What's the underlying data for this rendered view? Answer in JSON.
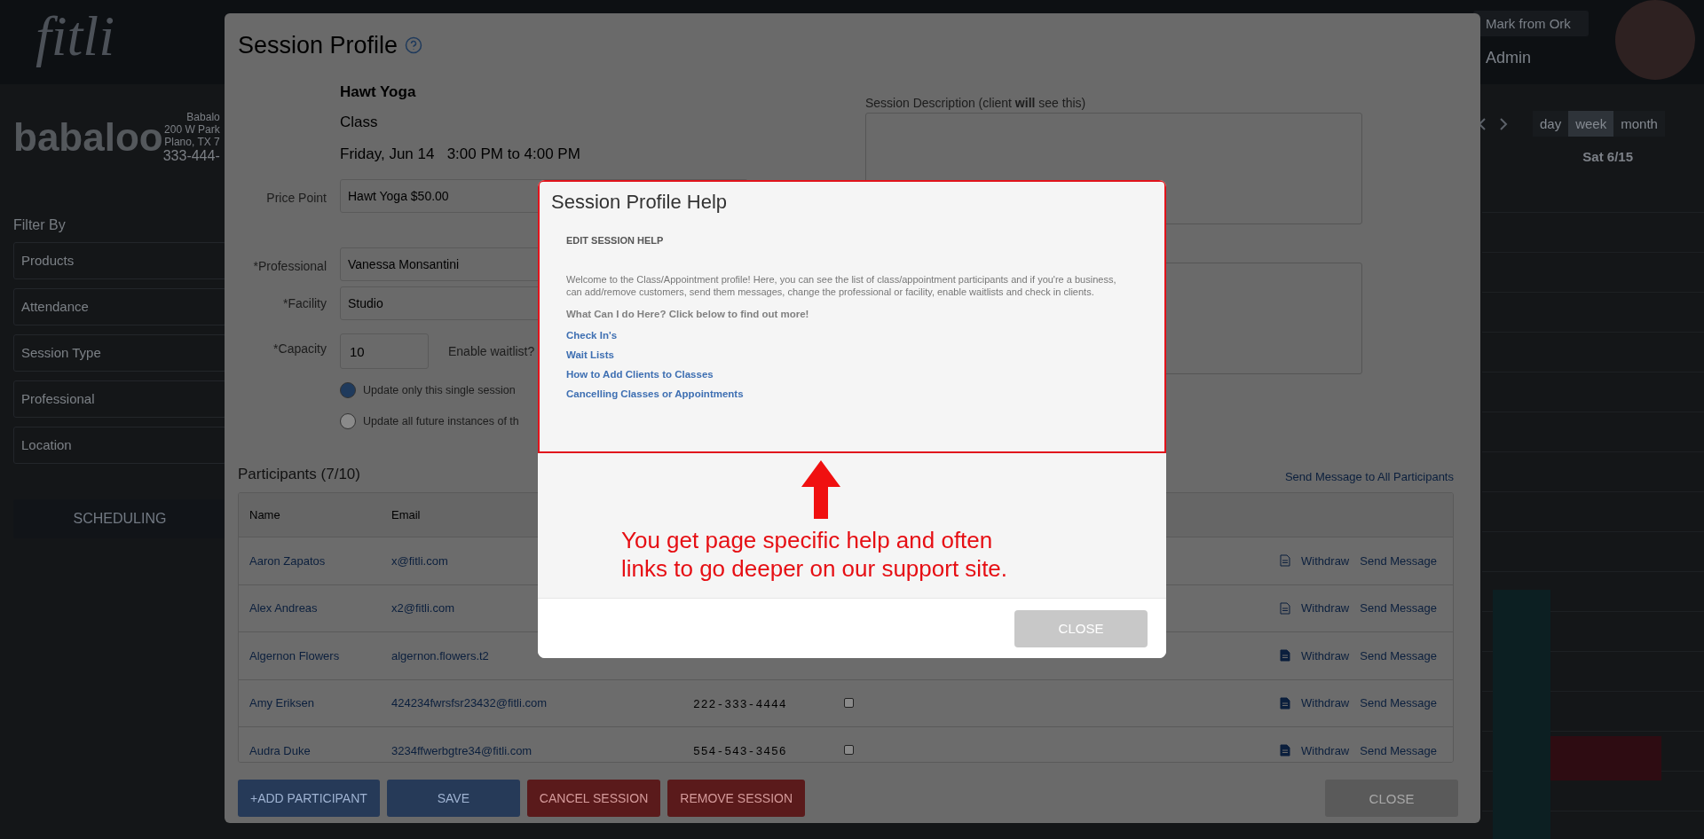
{
  "app_header": {
    "logo": "fitli",
    "account_menu": "Mark from Ork",
    "role": "Admin"
  },
  "business": {
    "logo": "babaloo",
    "address_lines": [
      "Babalo",
      "200 W Park",
      "Plano, TX 7"
    ],
    "phone": "333-444-"
  },
  "sidebar": {
    "filter_title": "Filter By",
    "filters": [
      "Products",
      "Attendance",
      "Session Type",
      "Professional",
      "Location"
    ],
    "scheduling_button": "SCHEDULING"
  },
  "calendar": {
    "views": [
      {
        "label": "day",
        "selected": false
      },
      {
        "label": "week",
        "selected": true
      },
      {
        "label": "month",
        "selected": false
      }
    ],
    "day_header": "Sat 6/15"
  },
  "session_profile": {
    "title": "Session Profile",
    "session_name": "Hawt Yoga",
    "session_type": "Class",
    "date": "Friday, Jun 14",
    "time": "3:00 PM to 4:00 PM",
    "fields": [
      {
        "label": "Price Point",
        "value": "Hawt Yoga $50.00"
      },
      {
        "label": "*Professional",
        "value": "Vanessa Monsantini"
      },
      {
        "label": "*Facility",
        "value": "Studio"
      }
    ],
    "capacity": {
      "label": "*Capacity",
      "value": "10"
    },
    "waitlist_label": "Enable waitlist?",
    "update_options": [
      {
        "label": "Update only this single session",
        "selected": true
      },
      {
        "label": "Update all future instances of th",
        "selected": false
      }
    ],
    "description_label": "Session Description (client **will** see this)",
    "participants_title": "Participants (7/10)",
    "send_all_link": "Send Message to All Participants",
    "columns": [
      "Name",
      "Email"
    ],
    "participants": [
      {
        "name": "Aaron Zapatos",
        "email": "x@fitli.com",
        "note_filled": false,
        "withdraw": "Withdraw",
        "send": "Send Message"
      },
      {
        "name": "Alex Andreas",
        "email": "x2@fitli.com",
        "note_filled": false,
        "withdraw": "Withdraw",
        "send": "Send Message"
      },
      {
        "name": "Algernon Flowers",
        "email": "algernon.flowers.t2",
        "note_filled": true,
        "withdraw": "Withdraw",
        "send": "Send Message"
      },
      {
        "name": "Amy Eriksen",
        "email": "424234fwrsfsr23432@fitli.com",
        "phone": "222-333-4444",
        "checked": false,
        "note_filled": true,
        "withdraw": "Withdraw",
        "send": "Send Message"
      },
      {
        "name": "Audra Duke",
        "email": "3234ffwerbgtre34@fitli.com",
        "phone": "554-543-3456",
        "checked": false,
        "note_filled": true,
        "withdraw": "Withdraw",
        "send": "Send Message"
      }
    ],
    "buttons": [
      {
        "label": "+ADD PARTICIPANT",
        "kind": "primary"
      },
      {
        "label": "SAVE",
        "kind": "primary"
      },
      {
        "label": "CANCEL SESSION",
        "kind": "danger"
      },
      {
        "label": "REMOVE SESSION",
        "kind": "danger"
      }
    ],
    "close_button": "CLOSE"
  },
  "help_dialog": {
    "title": "Session Profile Help",
    "heading": "EDIT SESSION HELP",
    "intro": "Welcome to the Class/Appointment profile!  Here, you can see the list of class/appointment participants and if you're a business, can add/remove customers, send them messages, change the professional or facility, enable waitlists and check in clients.",
    "prompt": "What Can I do Here? Click below to find out more!",
    "links": [
      "Check In's",
      "Wait Lists",
      "How to Add Clients to Classes",
      "Cancelling Classes or Appointments"
    ],
    "close_button": "CLOSE"
  },
  "annotation": {
    "lines": [
      "You get page specific help and often",
      "links to go deeper on our support site."
    ]
  }
}
